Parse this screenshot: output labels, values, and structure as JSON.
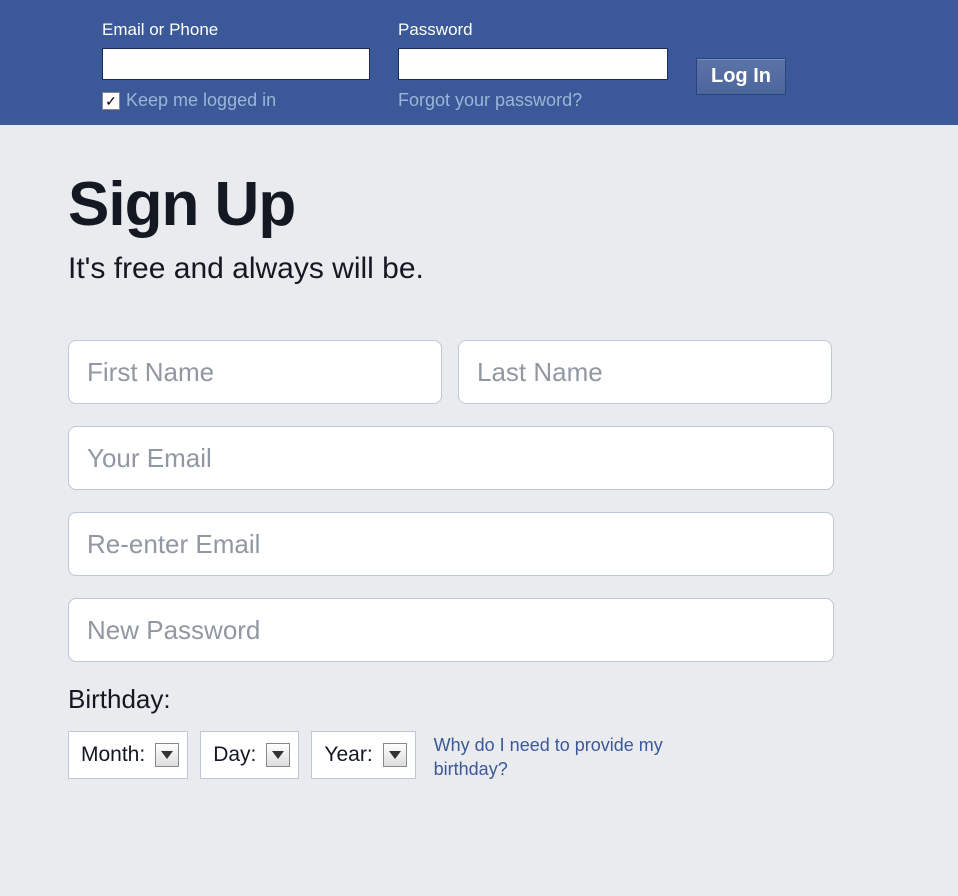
{
  "header": {
    "email_label": "Email or Phone",
    "password_label": "Password",
    "keep_logged_label": "Keep me logged in",
    "forgot_label": "Forgot your password?",
    "login_button": "Log In"
  },
  "signup": {
    "title": "Sign Up",
    "subtitle": "It's free and always will be.",
    "first_name_placeholder": "First Name",
    "last_name_placeholder": "Last Name",
    "email_placeholder": "Your Email",
    "reenter_email_placeholder": "Re-enter Email",
    "password_placeholder": "New Password",
    "birthday_label": "Birthday:",
    "month_label": "Month:",
    "day_label": "Day:",
    "year_label": "Year:",
    "birthday_help": "Why do I need to provide my birthday?"
  }
}
